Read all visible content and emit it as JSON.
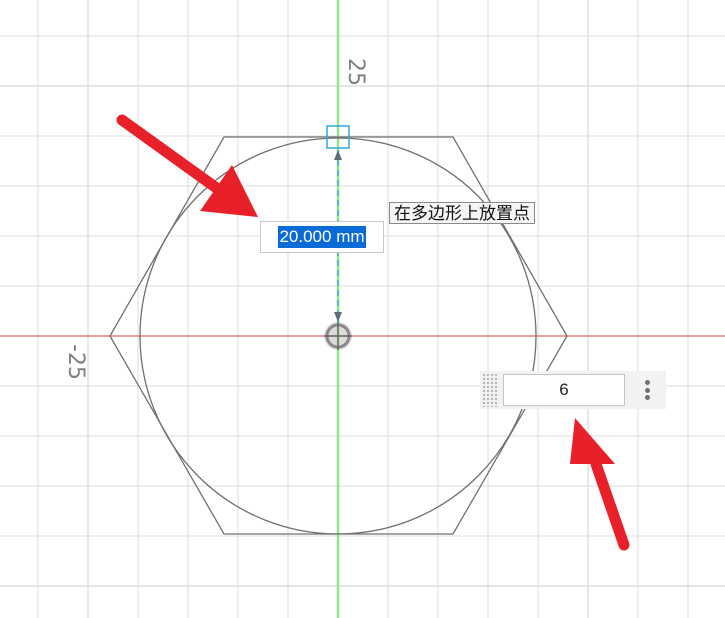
{
  "sketch": {
    "axis_labels": {
      "top": "25",
      "left": "-25"
    },
    "colors": {
      "grid": "#dedede",
      "x_axis": "#f08080",
      "y_axis": "#8ee68e",
      "shape_stroke": "#707070",
      "constraint_line": "#5aa7d6",
      "selection": "#0a6ad6",
      "arrow": "#e8202a"
    },
    "polygon_sides": 6,
    "icons": [
      "center-point-icon",
      "vertex-handle-icon",
      "more-options-icon",
      "grip-icon"
    ]
  },
  "dimension_input": {
    "value": "20.000 mm"
  },
  "tooltip": {
    "text": "在多边形上放置点"
  },
  "sides_input": {
    "value": "6"
  }
}
